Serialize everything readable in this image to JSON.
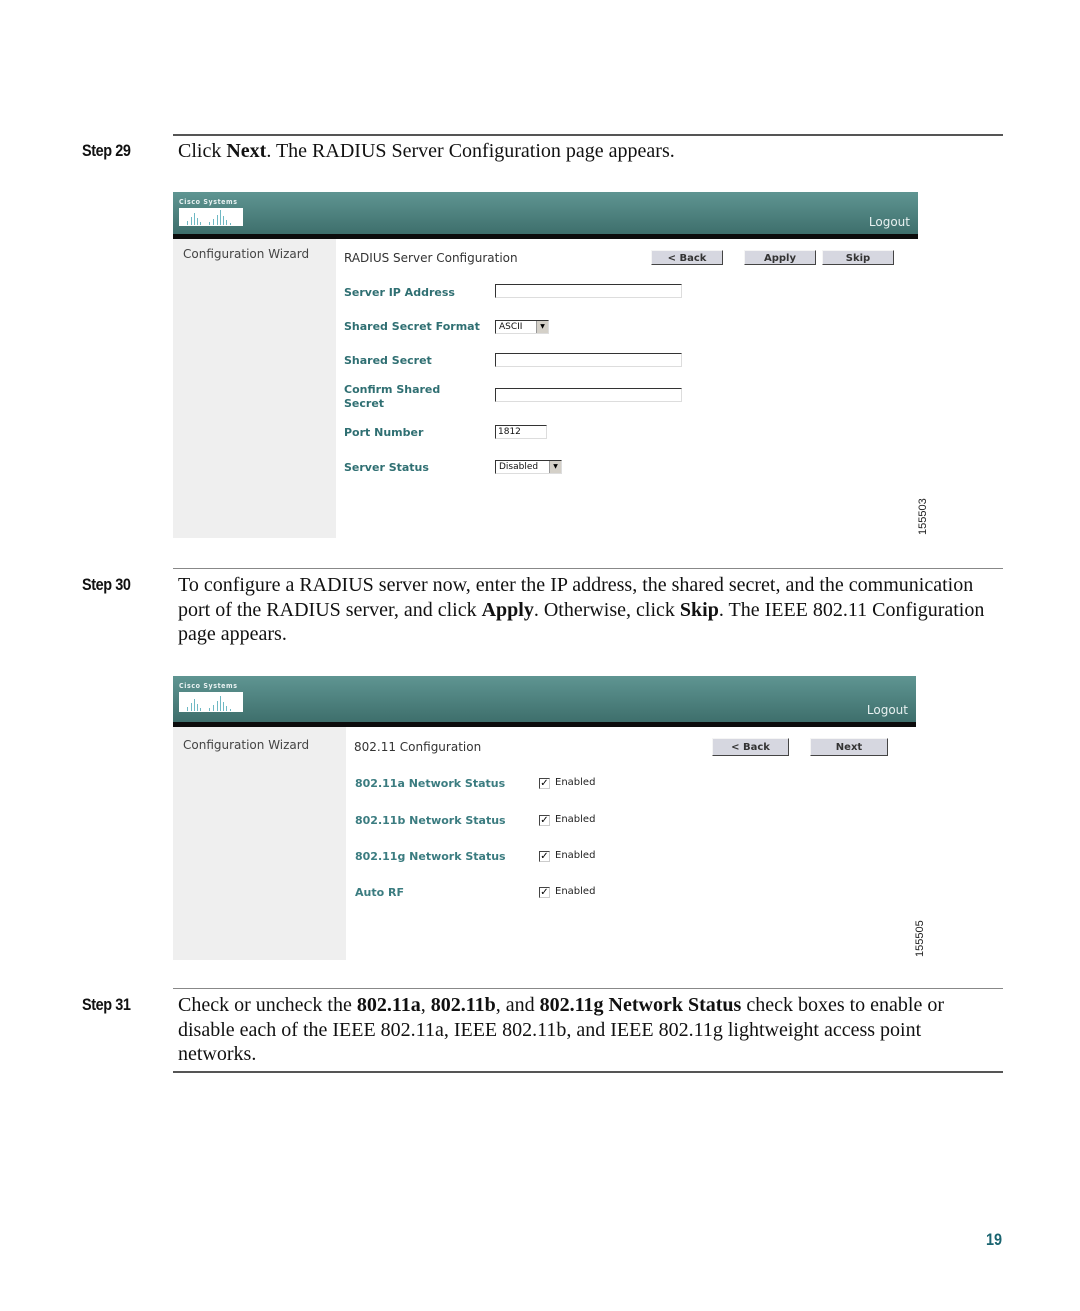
{
  "steps": [
    {
      "label": "Step 29",
      "parts": [
        "Click ",
        "Next",
        ". The RADIUS Server Configuration page appears."
      ]
    },
    {
      "label": "Step 30",
      "parts": [
        "To configure a RADIUS server now, enter the IP address, the shared secret, and the communication port of the RADIUS server, and click ",
        "Apply",
        ". Otherwise, click ",
        "Skip",
        ". The IEEE 802.11 Configuration page appears."
      ]
    },
    {
      "label": "Step 31",
      "parts": [
        "Check or uncheck the ",
        "802.11a",
        ", ",
        "802.11b",
        ", and ",
        "802.11g Network Status",
        " check boxes to enable or disable each of the IEEE 802.11a, IEEE 802.11b, and IEEE 802.11g lightweight access point networks."
      ]
    }
  ],
  "screenshot1": {
    "logo_text": "Cisco Systems",
    "logout": "Logout",
    "sidebar_title": "Configuration Wizard",
    "page_title": "RADIUS Server Configuration",
    "buttons": {
      "back": "< Back",
      "apply": "Apply",
      "skip": "Skip"
    },
    "fields": {
      "server_ip": {
        "label": "Server IP Address",
        "value": ""
      },
      "secret_format": {
        "label": "Shared Secret Format",
        "value": "ASCII"
      },
      "shared_secret": {
        "label": "Shared Secret",
        "value": ""
      },
      "confirm_secret": {
        "label": "Confirm Shared Secret",
        "value": ""
      },
      "port": {
        "label": "Port Number",
        "value": "1812"
      },
      "server_status": {
        "label": "Server Status",
        "value": "Disabled"
      }
    },
    "figure_id": "155503"
  },
  "screenshot2": {
    "logo_text": "Cisco Systems",
    "logout": "Logout",
    "sidebar_title": "Configuration Wizard",
    "page_title": "802.11 Configuration",
    "buttons": {
      "back": "< Back",
      "next": "Next"
    },
    "rows": [
      {
        "label": "802.11a Network Status",
        "checked": true,
        "status": "Enabled"
      },
      {
        "label": "802.11b Network Status",
        "checked": true,
        "status": "Enabled"
      },
      {
        "label": "802.11g Network Status",
        "checked": true,
        "status": "Enabled"
      },
      {
        "label": "Auto RF",
        "checked": true,
        "status": "Enabled"
      }
    ],
    "figure_id": "155505"
  },
  "page_number": "19",
  "colors": {
    "banner_top": "#5f9592",
    "banner_bottom": "#3e6f6c",
    "field_label": "#2f6f72",
    "page_number": "#1a6470"
  }
}
